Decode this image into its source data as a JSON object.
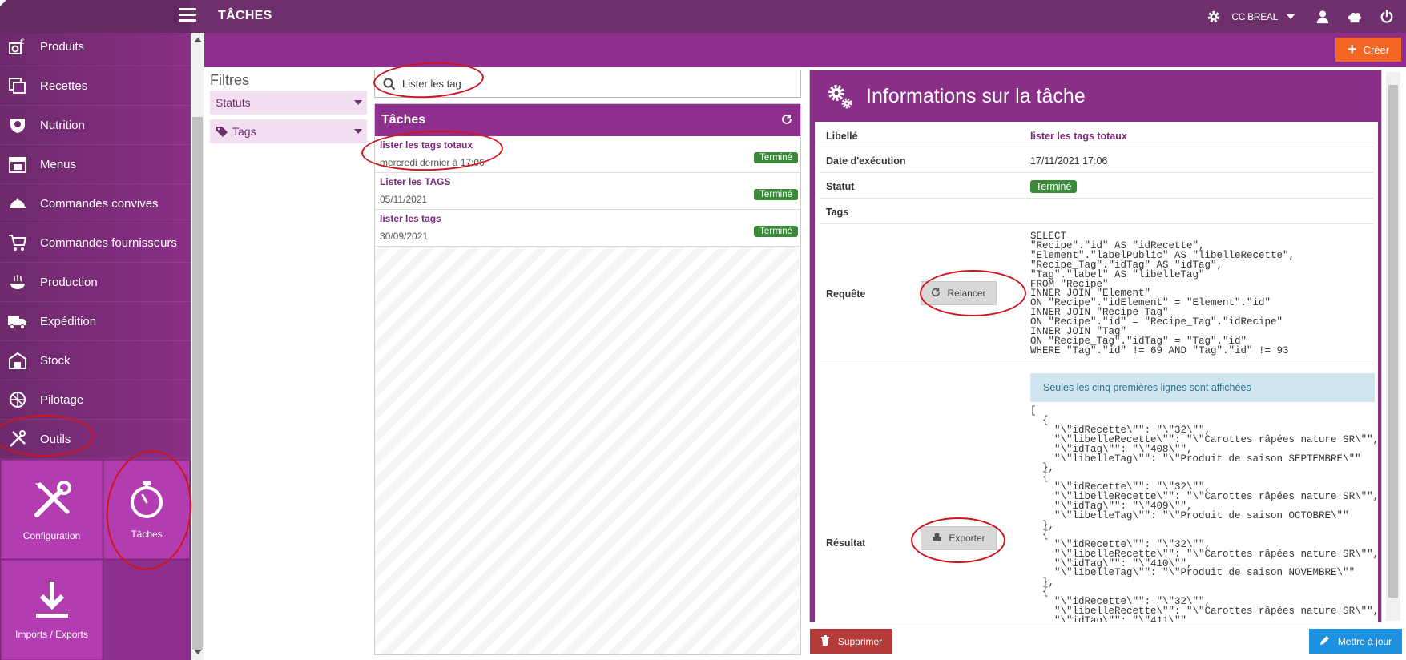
{
  "header": {
    "title": "TÂCHES",
    "user_name": "CC BREAL"
  },
  "toolbar": {
    "create_label": "Créer"
  },
  "sidebar": {
    "items": [
      {
        "label": "Produits",
        "icon": "products-icon"
      },
      {
        "label": "Recettes",
        "icon": "recipes-icon"
      },
      {
        "label": "Nutrition",
        "icon": "nutrition-icon"
      },
      {
        "label": "Menus",
        "icon": "menus-icon"
      },
      {
        "label": "Commandes convives",
        "icon": "guest-orders-icon"
      },
      {
        "label": "Commandes fournisseurs",
        "icon": "cart-icon"
      },
      {
        "label": "Production",
        "icon": "production-icon"
      },
      {
        "label": "Expédition",
        "icon": "truck-icon"
      },
      {
        "label": "Stock",
        "icon": "warehouse-icon"
      },
      {
        "label": "Pilotage",
        "icon": "pilotage-icon"
      },
      {
        "label": "Outils",
        "icon": "tools-icon"
      }
    ],
    "tiles": [
      {
        "label": "Configuration"
      },
      {
        "label": "Tâches"
      },
      {
        "label": "Imports / Exports"
      }
    ]
  },
  "filters": {
    "title": "Filtres",
    "statuts_label": "Statuts",
    "tags_label": "Tags"
  },
  "search": {
    "value": "Lister les tag"
  },
  "tasks": {
    "title": "Tâches",
    "rows": [
      {
        "name": "lister les tags totaux",
        "date": "mercredi dernier à 17:06",
        "status": "Terminé"
      },
      {
        "name": "Lister les TAGS",
        "date": "05/11/2021",
        "status": "Terminé"
      },
      {
        "name": "lister les tags",
        "date": "30/09/2021",
        "status": "Terminé"
      }
    ]
  },
  "info": {
    "title": "Informations sur la tâche",
    "libelle_label": "Libellé",
    "libelle_value": "lister les tags totaux",
    "date_label": "Date d'exécution",
    "date_value": "17/11/2021 17:06",
    "statut_label": "Statut",
    "statut_value": "Terminé",
    "tags_label": "Tags",
    "requete_label": "Requête",
    "relancer_label": "Relancer",
    "query": "SELECT\n\"Recipe\".\"id\" AS \"idRecette\",\n\"Element\".\"labelPublic\" AS \"libelleRecette\",\n\"Recipe_Tag\".\"idTag\" AS \"idTag\",\n\"Tag\".\"label\" AS \"libelleTag\"\nFROM \"Recipe\"\nINNER JOIN \"Element\"\nON \"Recipe\".\"idElement\" = \"Element\".\"id\"\nINNER JOIN \"Recipe_Tag\"\nON \"Recipe\".\"id\" = \"Recipe_Tag\".\"idRecipe\"\nINNER JOIN \"Tag\"\nON \"Recipe_Tag\".\"idTag\" = \"Tag\".\"id\"\nWHERE \"Tag\".\"id\" != 69 AND \"Tag\".\"id\" != 93",
    "resultat_label": "Résultat",
    "exporter_label": "Exporter",
    "alert": "Seules les cinq premières lignes sont affichées",
    "result": "[\n  {\n    \"\\\"idRecette\\\"\": \"\\\"32\\\"\",\n    \"\\\"libelleRecette\\\"\": \"\\\"Carottes râpées nature SR\\\"\",\n    \"\\\"idTag\\\"\": \"\\\"408\\\"\",\n    \"\\\"libelleTag\\\"\": \"\\\"Produit de saison SEPTEMBRE\\\"\"\n  },\n  {\n    \"\\\"idRecette\\\"\": \"\\\"32\\\"\",\n    \"\\\"libelleRecette\\\"\": \"\\\"Carottes râpées nature SR\\\"\",\n    \"\\\"idTag\\\"\": \"\\\"409\\\"\",\n    \"\\\"libelleTag\\\"\": \"\\\"Produit de saison OCTOBRE\\\"\"\n  },\n  {\n    \"\\\"idRecette\\\"\": \"\\\"32\\\"\",\n    \"\\\"libelleRecette\\\"\": \"\\\"Carottes râpées nature SR\\\"\",\n    \"\\\"idTag\\\"\": \"\\\"410\\\"\",\n    \"\\\"libelleTag\\\"\": \"\\\"Produit de saison NOVEMBRE\\\"\"\n  },\n  {\n    \"\\\"idRecette\\\"\": \"\\\"32\\\"\",\n    \"\\\"libelleRecette\\\"\": \"\\\"Carottes râpées nature SR\\\"\",\n    \"\\\"idTag\\\"\": \"\\\"411\\\"\","
  },
  "footer": {
    "delete_label": "Supprimer",
    "update_label": "Mettre à jour"
  },
  "colors": {
    "brand": "#6e2f6d",
    "accent": "#8f2f8d",
    "create": "#f26522",
    "success": "#3a8a3a",
    "danger": "#b53a3a",
    "primary": "#1e90e0",
    "annotation": "#d0141e"
  }
}
